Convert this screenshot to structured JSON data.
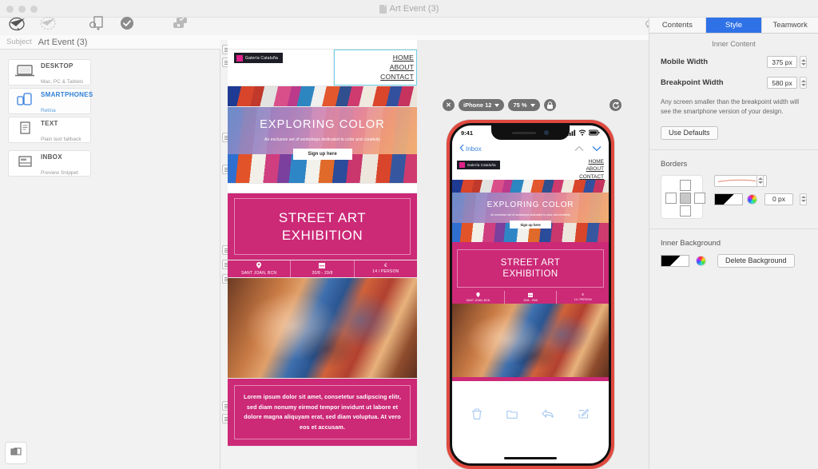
{
  "window": {
    "title": "Art Event (3)",
    "doc_icon": "document-icon"
  },
  "toolbar": {
    "left_icons": [
      "send-icon",
      "send-outline-icon",
      "package-icon",
      "check-circle-icon",
      "message-check-icon"
    ],
    "right_icons": [
      "cloud-icon",
      "layout-icon",
      "move-icon",
      "ruler-icon",
      "panel-icon"
    ]
  },
  "subject": {
    "label": "Subject",
    "value": "Art Event (3)"
  },
  "sidebar": {
    "items": [
      {
        "title": "DESKTOP",
        "sub": "Mac, PC & Tablets",
        "icon": "laptop-icon",
        "selected": false
      },
      {
        "title": "SMARTPHONES",
        "sub": "Retina",
        "icon": "phones-icon",
        "selected": true
      },
      {
        "title": "TEXT",
        "sub": "Plain text fallback",
        "icon": "text-document-icon",
        "selected": false
      },
      {
        "title": "INBOX",
        "sub": "Preview Snippet",
        "icon": "inbox-icon",
        "selected": false
      }
    ],
    "bottom_button_icon": "duplicate-layers-icon"
  },
  "email": {
    "logo_text": "Galería Cataluña",
    "nav": [
      "HOME",
      "ABOUT",
      "CONTACT"
    ],
    "hero": {
      "heading": "EXPLORING COLOR",
      "sub": "An exclusive set of workshops dedicated to color and creativity",
      "button": "Sign up here"
    },
    "street": {
      "line1": "STREET ART",
      "line2": "EXHIBITION"
    },
    "info": [
      {
        "icon": "location-pin-icon",
        "glyph": "⌕",
        "text": "SANT JOAN, BCN"
      },
      {
        "icon": "calendar-icon",
        "glyph": "▦",
        "text": "20/8 - 29/8"
      },
      {
        "icon": "euro-icon",
        "glyph": "€",
        "text": "14 / PERSON"
      }
    ],
    "lorem": "Lorem ipsum dolor sit amet, consetetur sadipscing elitr, sed diam nonumy eirmod tempor invidunt ut labore et dolore magna aliquyam erat, sed diam voluptua. At vero eos et accusam.",
    "accent_pink": "#cc2977",
    "logo_square": "#e0218a"
  },
  "preview_controls": {
    "close": "✕",
    "device": "iPhone 12",
    "zoom": "75 %",
    "lock_icon": "lock-icon",
    "refresh_icon": "refresh-icon"
  },
  "phone": {
    "status": {
      "time": "9:41",
      "signal_icon": "cellular-icon",
      "wifi_icon": "wifi-icon",
      "battery_icon": "battery-icon"
    },
    "nav": {
      "back_label": "Inbox",
      "back_icon": "chevron-left-icon",
      "up_icon": "chevron-up-icon",
      "down_icon": "chevron-down-icon"
    },
    "toolbar_icons": [
      "trash-icon",
      "folder-icon",
      "reply-icon",
      "compose-icon"
    ]
  },
  "right_panel": {
    "tabs": [
      {
        "label": "Contents",
        "active": false
      },
      {
        "label": "Style",
        "active": true
      },
      {
        "label": "Teamwork",
        "active": false
      }
    ],
    "section_title": "Inner Content",
    "mobile_width": {
      "label": "Mobile Width",
      "value": "375 px"
    },
    "breakpoint_width": {
      "label": "Breakpoint Width",
      "value": "580 px"
    },
    "help_text": "Any screen smaller than the breakpoint width will see the smartphone version of your design.",
    "use_defaults": "Use Defaults",
    "borders": {
      "title": "Borders",
      "width_value": "0 px"
    },
    "inner_background": {
      "title": "Inner Background",
      "delete_label": "Delete Background"
    },
    "accent_blue": "#2f72e8"
  }
}
